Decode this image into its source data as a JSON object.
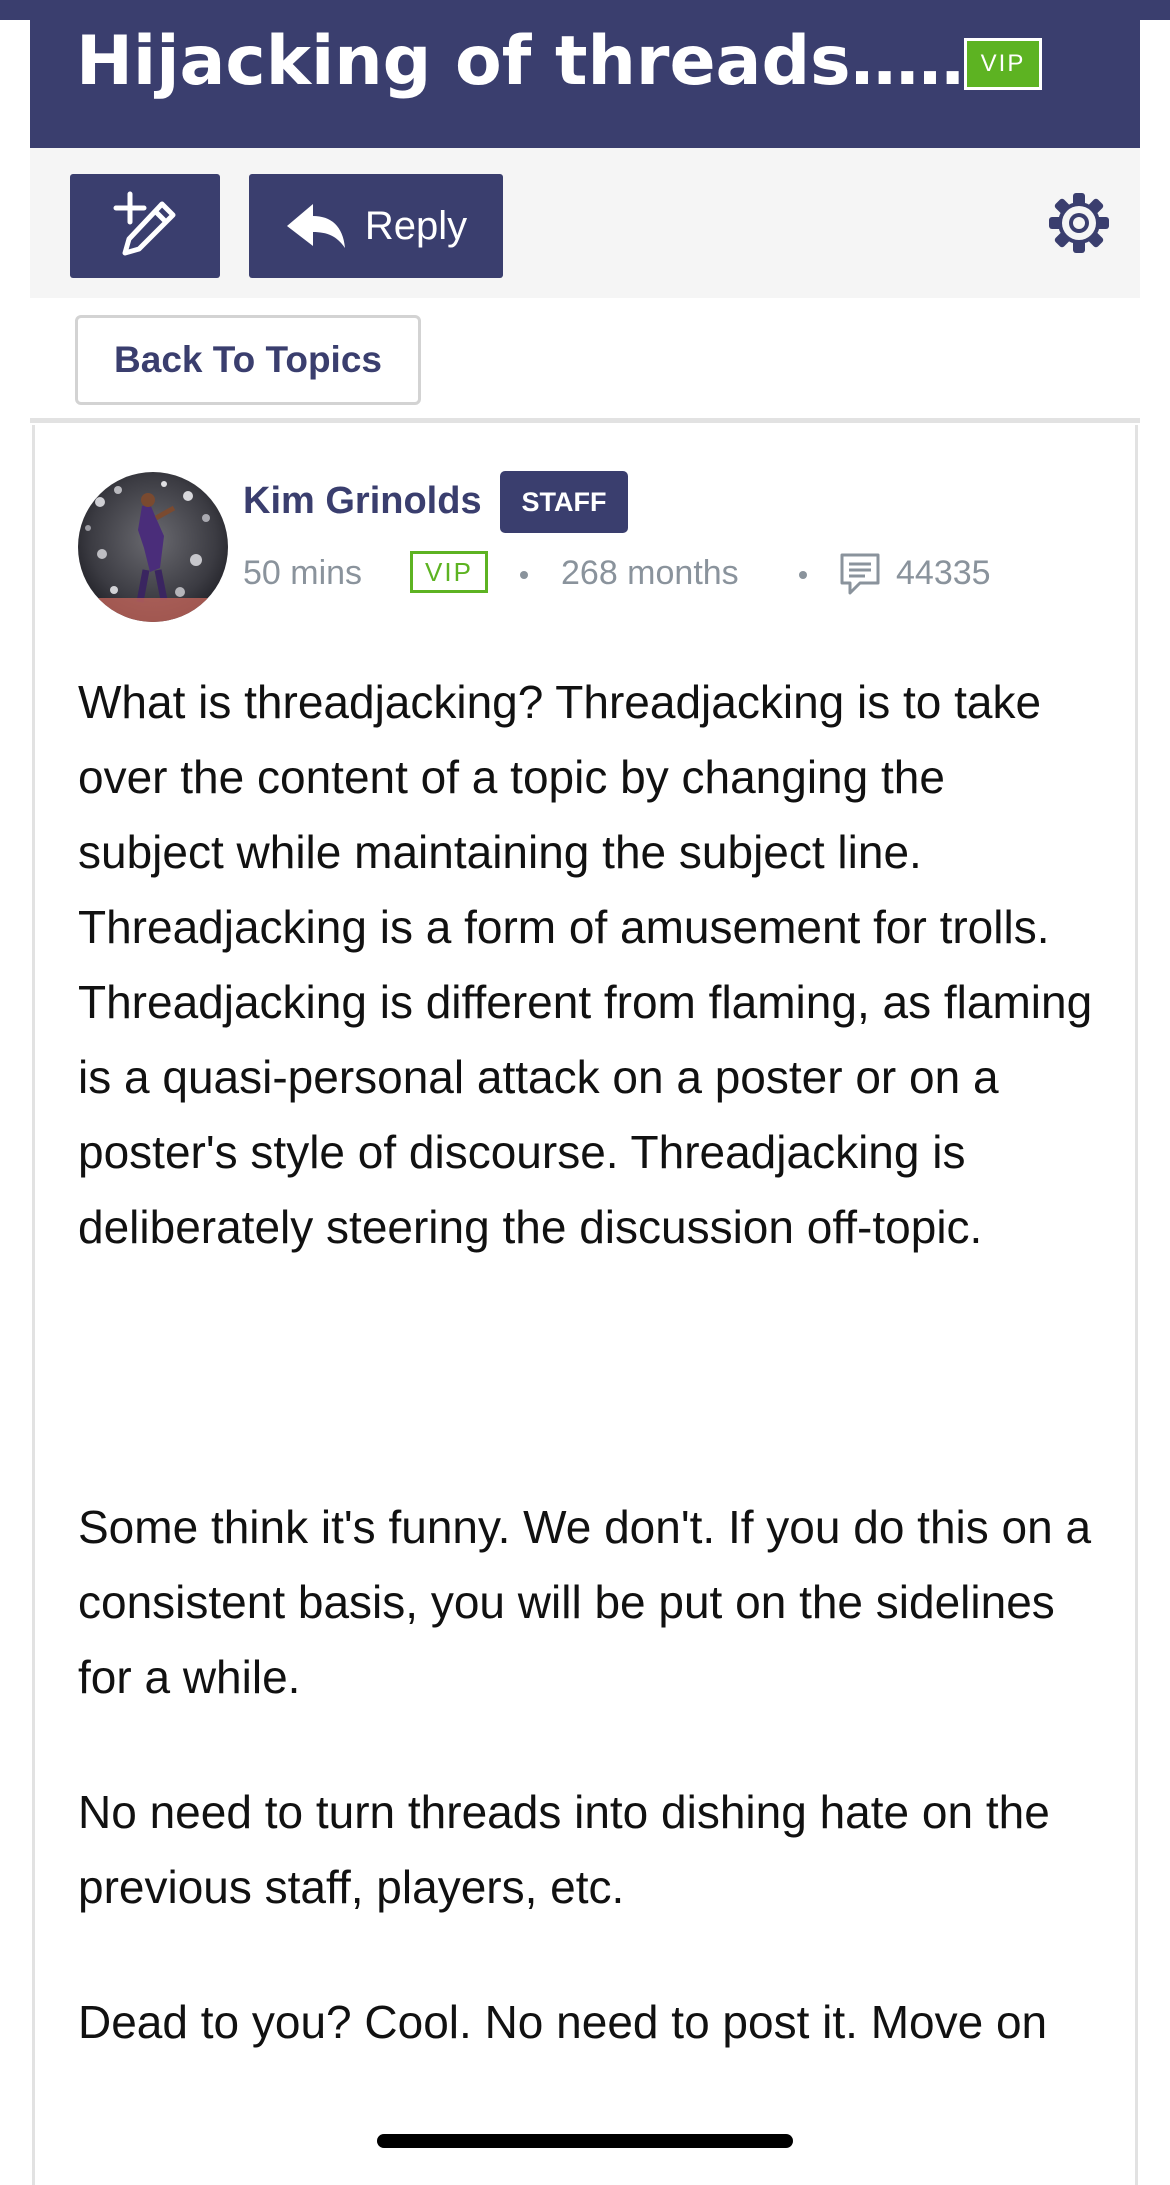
{
  "thread": {
    "title": "Hijacking of threads……",
    "title_badge": "VIP"
  },
  "toolbar": {
    "new_topic_icon": "pencil-plus-icon",
    "reply_icon": "reply-arrow-icon",
    "reply_label": "Reply",
    "settings_icon": "gear-icon"
  },
  "nav": {
    "back_label": "Back To Topics"
  },
  "post": {
    "author": "Kim Grinolds",
    "role_badge": "STAFF",
    "posted_ago": "50 mins",
    "member_badge": "VIP",
    "member_for": "268 months",
    "comments_icon": "comments-icon",
    "post_count": "44335",
    "paragraphs": [
      "What is threadjacking? Threadjacking is to take over the content of a topic by changing the subject while maintaining the subject line. Threadjacking is a form of amusement for trolls. Threadjacking is different from flaming, as flaming is a quasi-personal attack on a poster or on a poster's style of discourse. Threadjacking is deliberately steering the discussion off-topic.",
      "Some think it's funny. We don't. If you do this on a consistent basis, you will be put on the sidelines for a while.",
      "No need to turn threads into dishing hate on the previous staff, players, etc.",
      "Dead to you? Cool. No need to post it. Move on"
    ]
  },
  "colors": {
    "brand_navy": "#3a3e6e",
    "vip_green": "#5db322",
    "meta_gray": "#8a939c"
  }
}
